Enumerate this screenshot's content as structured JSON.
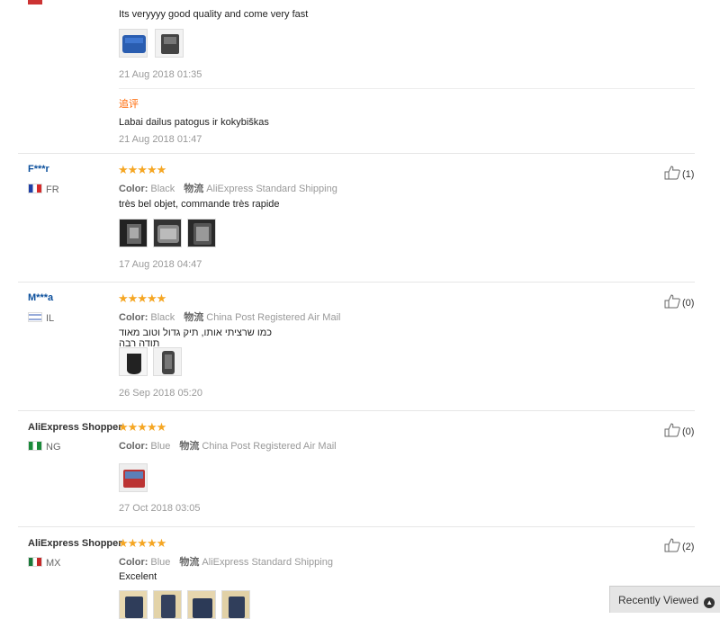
{
  "top_review": {
    "text": "Its veryyyy good quality and come very fast",
    "date": "21 Aug 2018 01:35",
    "additional_label": "追评",
    "additional_text": "Labai dailus patogus ir kokybiškas",
    "additional_date": "21 Aug 2018 01:47"
  },
  "labels": {
    "color": "Color:",
    "shipping": "物流"
  },
  "reviews": [
    {
      "user": "F***r",
      "country": "FR",
      "stars": "★★★★★",
      "color": "Black",
      "shipping": "AliExpress Standard Shipping",
      "text": "très bel objet, commande très rapide",
      "date": "17 Aug 2018 04:47",
      "helpful": "(1)"
    },
    {
      "user": "M***a",
      "country": "IL",
      "stars": "★★★★★",
      "color": "Black",
      "shipping": "China Post Registered Air Mail",
      "text": "כמו שרציתי אותו, תיק גדול וטוב מאוד תודה רבה",
      "date": "26 Sep 2018 05:20",
      "helpful": "(0)"
    },
    {
      "user": "AliExpress Shopper",
      "country": "NG",
      "stars": "★★★★★",
      "color": "Blue",
      "shipping": "China Post Registered Air Mail",
      "text": "",
      "date": "27 Oct 2018 03:05",
      "helpful": "(0)"
    },
    {
      "user": "AliExpress Shopper",
      "country": "MX",
      "stars": "★★★★★",
      "color": "Blue",
      "shipping": "AliExpress Standard Shipping",
      "text": "Excelent",
      "date": "",
      "helpful": "(2)"
    }
  ],
  "recently_viewed": "Recently Viewed",
  "colors": {
    "star": "#f5a623",
    "username": "#0b4f9c",
    "additional": "#ff6600"
  }
}
